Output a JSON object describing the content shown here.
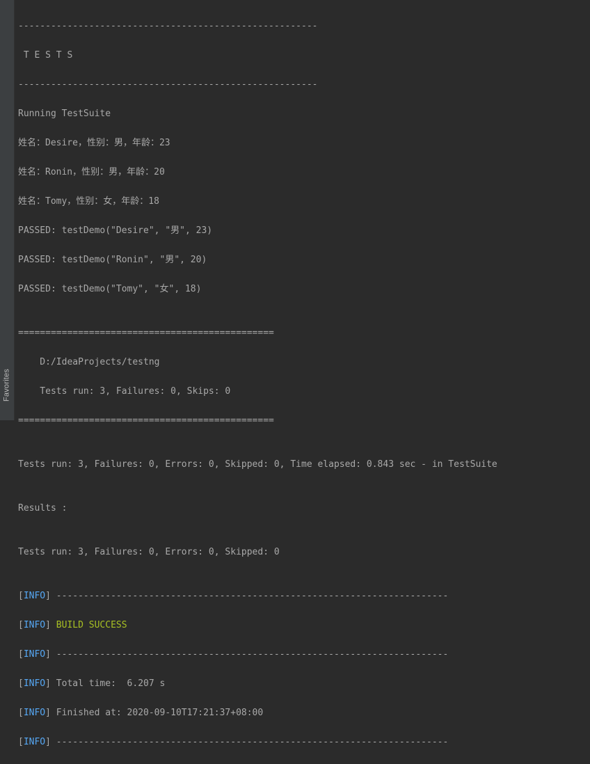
{
  "sidebar": {
    "favorites_label": "Favorites"
  },
  "console": {
    "sep_top1": "-------------------------------------------------------",
    "tests_header": " T E S T S",
    "sep_top2": "-------------------------------------------------------",
    "running": "Running TestSuite",
    "row1": "姓名：Desire，性别：男，年龄：23",
    "row2": "姓名：Ronin，性别：男，年龄：20",
    "row3": "姓名：Tomy，性别：女，年龄：18",
    "passed1": "PASSED: testDemo(\"Desire\", \"男\", 23)",
    "passed2": "PASSED: testDemo(\"Ronin\", \"男\", 20)",
    "passed3": "PASSED: testDemo(\"Tomy\", \"女\", 18)",
    "blank": "",
    "sep_eq1": "===============================================",
    "proj_path": "    D:/IdeaProjects/testng",
    "run_summary1": "    Tests run: 3, Failures: 0, Skips: 0",
    "sep_eq2": "===============================================",
    "run_summary2": "Tests run: 3, Failures: 0, Errors: 0, Skipped: 0, Time elapsed: 0.843 sec - in TestSuite",
    "results_header": "Results :",
    "run_summary3": "Tests run: 3, Failures: 0, Errors: 0, Skipped: 0",
    "info_label": "INFO",
    "bracket_open": "[",
    "bracket_close_sp": "] ",
    "dash_line": "------------------------------------------------------------------------",
    "build_success": "BUILD SUCCESS",
    "total_time": "Total time:  6.207 s",
    "finished_at": "Finished at: 2020-09-10T17:21:37+08:00"
  }
}
